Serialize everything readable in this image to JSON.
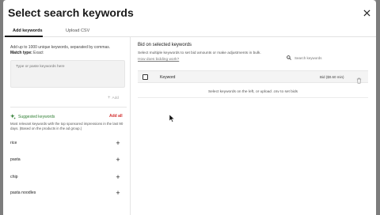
{
  "modal": {
    "title": "Select search keywords",
    "close_icon": "close-icon"
  },
  "tabs": [
    {
      "label": "Add keywords",
      "active": true
    },
    {
      "label": "Upload CSV",
      "active": false
    }
  ],
  "left": {
    "hint": "Add up to 1000 unique keywords, separated by commas.",
    "match_label": "Match type:",
    "match_value": "Exact",
    "textarea_placeholder": "Type or paste keywords here",
    "add_label": "Add",
    "suggested": {
      "heading": "Suggested keywords",
      "add_all": "Add all",
      "description": "Most relevant keywords with the top sponsored impressions in the last 90 days. (Based on the products in the ad group.)",
      "items": [
        "rice",
        "pasta",
        "chip",
        "pasta noodles"
      ]
    }
  },
  "right": {
    "title": "Bid on selected keywords",
    "subtitle": "Select multiple keywords to set bid amounts or make adjustments in bulk.",
    "link": "How does bidding work?",
    "search_placeholder": "Search keywords",
    "table": {
      "col_keyword": "Keyword",
      "col_bid": "Bid ($0.60 min)"
    },
    "empty_message": "Select keywords on the left, or upload .csv to set bids"
  },
  "colors": {
    "accent_green": "#2e7d32",
    "add_all_red": "#d32f2f"
  }
}
